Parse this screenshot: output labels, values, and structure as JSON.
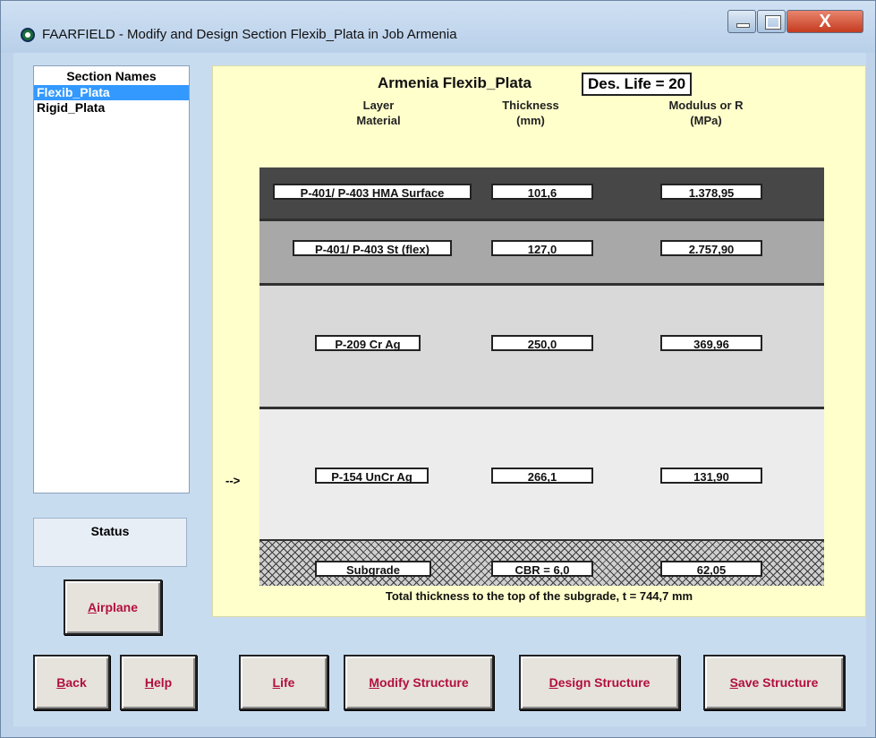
{
  "window": {
    "title": "FAARFIELD - Modify and Design Section Flexib_Plata in Job Armenia",
    "close_glyph": "X"
  },
  "sections": {
    "header": "Section Names",
    "items": [
      "Flexib_Plata",
      "Rigid_Plata"
    ],
    "selected": "Flexib_Plata"
  },
  "status": {
    "label": "Status"
  },
  "buttons": {
    "airplane": "Airplane",
    "back": "Back",
    "help": "Help",
    "life": "Life",
    "modify": "Modify Structure",
    "design": "Design Structure",
    "save": "Save Structure"
  },
  "structure": {
    "title": "Armenia  Flexib_Plata",
    "des_life": "Des. Life = 20",
    "col_material": [
      "Layer",
      "Material"
    ],
    "col_thickness": [
      "Thickness",
      "(mm)"
    ],
    "col_modulus": [
      "Modulus or R",
      "(MPa)"
    ],
    "current_marker": "-->",
    "layers": [
      {
        "material": "P-401/ P-403 HMA Surface",
        "thickness": "101,6",
        "modulus": "1.378,95"
      },
      {
        "material": "P-401/ P-403 St (flex)",
        "thickness": "127,0",
        "modulus": "2.757,90"
      },
      {
        "material": "P-209 Cr Ag",
        "thickness": "250,0",
        "modulus": "369,96"
      },
      {
        "material": "P-154 UnCr Ag",
        "thickness": "266,1",
        "modulus": "131,90"
      }
    ],
    "subgrade": {
      "material": "Subgrade",
      "thickness": "CBR = 6,0",
      "modulus": "62,05"
    },
    "total": "Total thickness to the top of the subgrade, t = 744,7 mm"
  },
  "colors": {
    "selection": "#3399ff",
    "button_text": "#b1103d",
    "panel_yellow": "#ffffcc"
  }
}
